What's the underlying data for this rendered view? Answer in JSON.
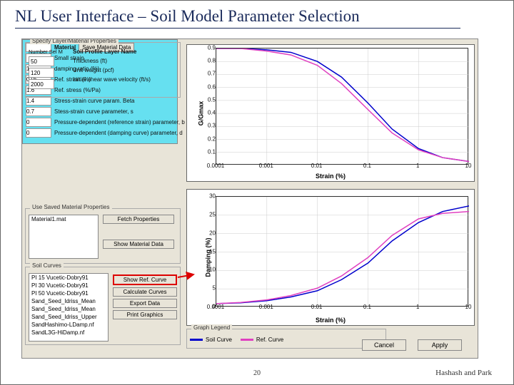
{
  "header": {
    "title": "NL User Interface – Soil Model Parameter Selection"
  },
  "footer": {
    "page": "20",
    "authors": "Hashash and Park"
  },
  "profile": {
    "group_label": "Specify Layer/Material Properties",
    "layer_label": "Number Sel M",
    "name_label": "Soil Profile Layer Name",
    "thickness_val": "50",
    "thickness_label": "Thickness (ft)",
    "unitwt_val": "120",
    "unitwt_label": "Unit weight (pcf)",
    "vs_val": "2000",
    "vs_label": "Initial shear wave velocity (ft/s)"
  },
  "material": {
    "material_label": "Material",
    "save_btn": "Save Material Data",
    "rows": [
      {
        "val": "",
        "label": "Small strain"
      },
      {
        "val": "1",
        "label": "damping ratio (%)"
      },
      {
        "val": "0.05",
        "label": "Ref. strain (%)"
      },
      {
        "val": "1.6",
        "label": "Ref. stress (%/Pa)"
      },
      {
        "val": "1.4",
        "label": "Stress-strain curve param. Beta"
      },
      {
        "val": "0.7",
        "label": "Stess-strain curve parameter, s"
      },
      {
        "val": "0",
        "label": "Pressure-dependent (reference strain) parameter, b"
      },
      {
        "val": "0",
        "label": "Pressure-dependent (damping curve) parameter, d"
      }
    ]
  },
  "saved": {
    "group_label": "Use Saved Material Properties",
    "items": [
      "Material1.mat"
    ],
    "fetch_btn": "Fetch Properties",
    "show_btn": "Show Material Data"
  },
  "curves": {
    "group_label": "Soil Curves",
    "items": [
      "PI 15 Vucetic-Dobry91",
      "PI 30 Vucetic-Dobry91",
      "PI 50 Vucetic-Dobry91",
      "Sand_Seed_Idriss_Mean",
      "Sand_Seed_Idriss_Mean",
      "Sand_Seed_Idriss_Upper",
      "SandHashimo-LDamp.nf",
      "SandL3G-HiDamp.nf"
    ],
    "show_ref_btn": "Show Ref. Curve",
    "calc_btn": "Calculate Curves",
    "export_btn": "Export Data",
    "print_btn": "Print Graphics"
  },
  "legend": {
    "group_label": "Graph Legend",
    "soil": "Soil Curve",
    "ref": "Ref. Curve"
  },
  "buttons": {
    "cancel": "Cancel",
    "apply": "Apply"
  },
  "chart_data": [
    {
      "type": "line",
      "title": "",
      "xlabel": "Strain (%)",
      "ylabel": "G/Gmax",
      "xlim": [
        0.0001,
        10
      ],
      "ylim": [
        0,
        0.9
      ],
      "xscale": "log",
      "xticks": [
        0.0001,
        0.001,
        0.01,
        0.1,
        1,
        10
      ],
      "yticks": [
        0.1,
        0.2,
        0.3,
        0.4,
        0.5,
        0.6,
        0.7,
        0.8,
        0.9
      ],
      "series": [
        {
          "name": "Soil Curve",
          "color": "#0000cc",
          "x": [
            0.0001,
            0.0003,
            0.001,
            0.003,
            0.01,
            0.03,
            0.1,
            0.3,
            1,
            3,
            10
          ],
          "y": [
            0.9,
            0.9,
            0.89,
            0.87,
            0.8,
            0.68,
            0.48,
            0.28,
            0.13,
            0.06,
            0.03
          ]
        },
        {
          "name": "Ref. Curve",
          "color": "#e040c0",
          "x": [
            0.0001,
            0.0003,
            0.001,
            0.003,
            0.01,
            0.03,
            0.1,
            0.3,
            1,
            3,
            10
          ],
          "y": [
            0.9,
            0.9,
            0.88,
            0.85,
            0.77,
            0.63,
            0.43,
            0.25,
            0.12,
            0.06,
            0.03
          ]
        }
      ]
    },
    {
      "type": "line",
      "title": "",
      "xlabel": "Strain (%)",
      "ylabel": "Damping (%)",
      "xlim": [
        0.0001,
        10
      ],
      "ylim": [
        0,
        30
      ],
      "xscale": "log",
      "xticks": [
        0.0001,
        0.001,
        0.01,
        0.1,
        1,
        10
      ],
      "yticks": [
        0,
        5,
        10,
        15,
        20,
        25,
        30
      ],
      "series": [
        {
          "name": "Soil Curve",
          "color": "#0000cc",
          "x": [
            0.0001,
            0.0003,
            0.001,
            0.003,
            0.01,
            0.03,
            0.1,
            0.3,
            1,
            3,
            10
          ],
          "y": [
            1,
            1.2,
            1.8,
            2.8,
            4.5,
            7.5,
            12,
            18,
            23,
            26,
            27.5
          ]
        },
        {
          "name": "Ref. Curve",
          "color": "#e040c0",
          "x": [
            0.0001,
            0.0003,
            0.001,
            0.003,
            0.01,
            0.03,
            0.1,
            0.3,
            1,
            3,
            10
          ],
          "y": [
            1,
            1.3,
            2,
            3.2,
            5.2,
            8.5,
            13.5,
            19.5,
            24,
            25.5,
            26
          ]
        }
      ]
    }
  ]
}
